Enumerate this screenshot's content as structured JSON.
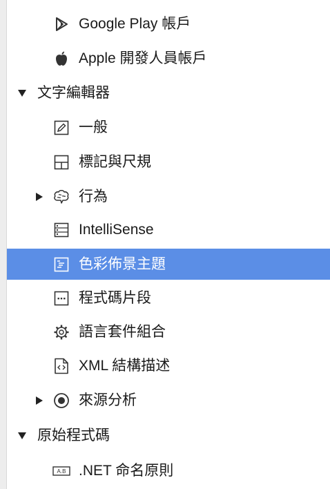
{
  "tree": {
    "items": [
      {
        "label": "Google Play 帳戶",
        "icon": "play-store-icon"
      },
      {
        "label": "Apple 開發人員帳戶",
        "icon": "apple-icon"
      },
      {
        "label": "文字編輯器",
        "expanded": true
      },
      {
        "label": "一般",
        "icon": "pencil-edit-icon"
      },
      {
        "label": "標記與尺規",
        "icon": "grid-ruler-icon"
      },
      {
        "label": "行為",
        "icon": "brain-icon",
        "expandable": true
      },
      {
        "label": "IntelliSense",
        "icon": "list-icon"
      },
      {
        "label": "色彩佈景主題",
        "icon": "color-theme-icon",
        "selected": true
      },
      {
        "label": "程式碼片段",
        "icon": "snippet-icon"
      },
      {
        "label": "語言套件組合",
        "icon": "gear-icon"
      },
      {
        "label": "XML 結構描述",
        "icon": "xml-file-icon"
      },
      {
        "label": "來源分析",
        "icon": "radio-target-icon",
        "expandable": true
      },
      {
        "label": "原始程式碼",
        "expanded": true
      },
      {
        "label": ".NET 命名原則",
        "icon": "naming-icon"
      }
    ]
  },
  "colors": {
    "selection": "#5b8ee6",
    "text": "#1a1a1a",
    "icon": "#333333"
  }
}
